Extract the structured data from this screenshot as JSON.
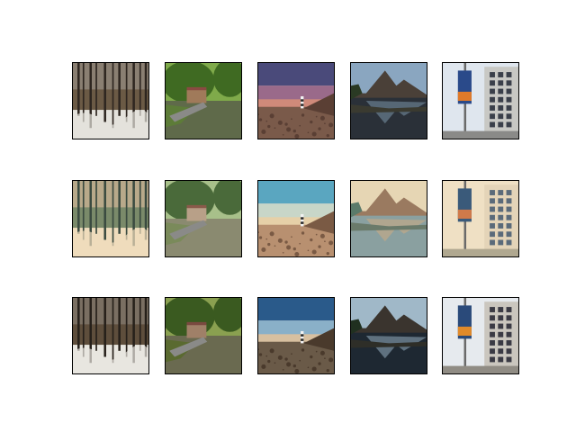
{
  "figure": {
    "rows": 3,
    "columns": 5,
    "background": "#ffffff",
    "frame_color": "#000000",
    "images": [
      [
        {
          "subject": "snowy-forest",
          "variant": "original"
        },
        {
          "subject": "canal-boat",
          "variant": "original"
        },
        {
          "subject": "lighthouse-dusk",
          "variant": "original"
        },
        {
          "subject": "mountain-lake",
          "variant": "original"
        },
        {
          "subject": "street-banner-building",
          "variant": "original"
        }
      ],
      [
        {
          "subject": "snowy-forest",
          "variant": "stylized"
        },
        {
          "subject": "canal-boat",
          "variant": "stylized"
        },
        {
          "subject": "lighthouse-dusk",
          "variant": "stylized"
        },
        {
          "subject": "mountain-lake",
          "variant": "stylized"
        },
        {
          "subject": "street-banner-building",
          "variant": "stylized"
        }
      ],
      [
        {
          "subject": "snowy-forest",
          "variant": "reconstructed"
        },
        {
          "subject": "canal-boat",
          "variant": "reconstructed"
        },
        {
          "subject": "lighthouse-dusk",
          "variant": "reconstructed"
        },
        {
          "subject": "mountain-lake",
          "variant": "reconstructed"
        },
        {
          "subject": "street-banner-building",
          "variant": "reconstructed"
        }
      ]
    ]
  }
}
